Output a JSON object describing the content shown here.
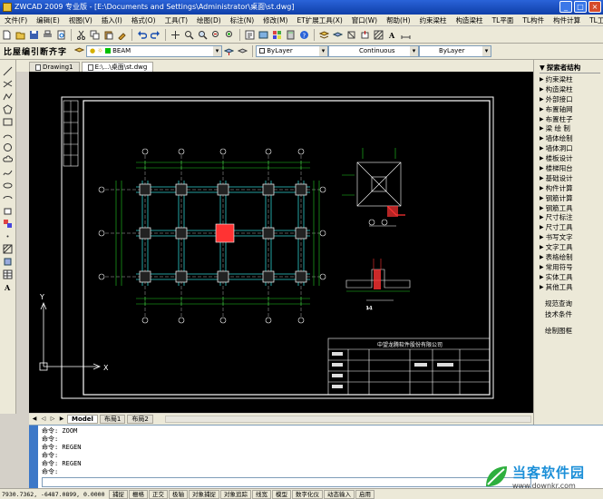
{
  "window": {
    "title": "ZWCAD 2009 专业版 - [E:\\Documents and Settings\\Administrator\\桌面\\st.dwg]"
  },
  "menu": [
    "文件(F)",
    "编辑(E)",
    "视图(V)",
    "插入(I)",
    "格式(O)",
    "工具(T)",
    "绘图(D)",
    "标注(N)",
    "修改(M)",
    "ET扩展工具(X)",
    "窗口(W)",
    "帮助(H)",
    "约束梁柱",
    "构造梁柱",
    "TL平面",
    "TL构件",
    "构件计算",
    "TL工具"
  ],
  "toolbar2": {
    "logo": "比屋编引断齐字",
    "layer_name": "BEAM",
    "color_value": "ByLayer",
    "linetype_value": "Continuous",
    "lineweight_value": "ByLayer"
  },
  "tabs": [
    {
      "label": "Drawing1",
      "active": false
    },
    {
      "label": "E:\\...\\桌面\\st.dwg",
      "active": true
    }
  ],
  "layout_tabs": [
    {
      "label": "Model",
      "active": true
    },
    {
      "label": "布局1",
      "active": false
    },
    {
      "label": "布局2",
      "active": false
    }
  ],
  "right_panel": {
    "title": "探索者结构",
    "items": [
      "约束梁柱",
      "构造梁柱",
      "外部接口",
      "布置轴网",
      "布置柱子",
      "梁 绘 制",
      "墙体绘制",
      "墙体洞口",
      "楼板设计",
      "楼梯阳台",
      "基础设计",
      "构件计算",
      "钢筋计算",
      "钢筋工具",
      "尺寸标注",
      "尺寸工具",
      "书写文字",
      "文字工具",
      "表格绘制",
      "常用符号",
      "实体工具",
      "其他工具"
    ],
    "extra": [
      "规范查询",
      "技术条件",
      "绘制图框"
    ]
  },
  "drawing": {
    "title_block_title": "中望龙腾软件股份有限公司",
    "ucs_x": "X",
    "ucs_y": "Y"
  },
  "command_lines": [
    "命令: ZOOM",
    "命令:",
    "命令: REGEN",
    "命令:",
    "命令: REGEN",
    "命令:"
  ],
  "status": {
    "coords": "7930.7362, -6487.0899, 0.0000",
    "buttons": [
      "捕捉",
      "栅格",
      "正交",
      "极轴",
      "对象捕捉",
      "对象追踪",
      "线宽",
      "模型",
      "数字化仪",
      "动态输入",
      "启用"
    ]
  },
  "watermark": {
    "text": "当客软件园",
    "url": "www.downkr.com"
  },
  "colors": {
    "cad_bg": "#000000",
    "column": "#ff3333",
    "dim": "#22cc22",
    "axis": "#dddddd"
  }
}
